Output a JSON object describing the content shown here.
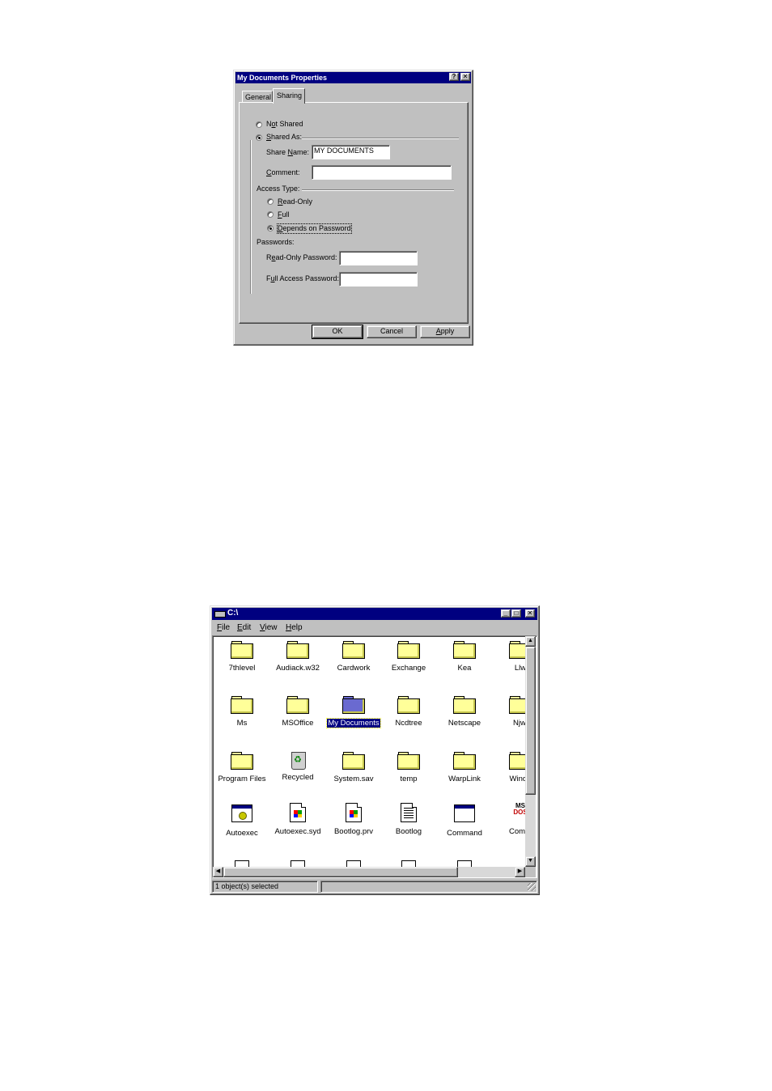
{
  "dialog": {
    "title": "My Documents Properties",
    "help_glyph": "?",
    "close_glyph": "✕",
    "tabs": [
      {
        "label": "General",
        "active": false
      },
      {
        "label": "Sharing",
        "active": true
      }
    ],
    "share_options": [
      {
        "label": "Not Shared",
        "accel_index": 1,
        "selected": false
      },
      {
        "label": "Shared As:",
        "accel_index": 0,
        "selected": true
      }
    ],
    "share_name": {
      "label": "Share Name:",
      "value": "MY DOCUMENTS"
    },
    "comment": {
      "label": "Comment:",
      "value": ""
    },
    "access_type": {
      "label": "Access Type:",
      "options": [
        {
          "label": "Read-Only",
          "selected": false
        },
        {
          "label": "Full",
          "selected": false
        },
        {
          "label": "Depends on Password",
          "selected": true
        }
      ]
    },
    "passwords": {
      "label": "Passwords:",
      "read_only_label": "Read-Only Password:",
      "full_access_label": "Full Access Password:"
    },
    "buttons": {
      "ok": "OK",
      "cancel": "Cancel",
      "apply": "Apply"
    }
  },
  "explorer": {
    "title": "C:\\",
    "controls": {
      "minimize": "_",
      "maximize": "□",
      "close": "✕"
    },
    "menu": [
      "File",
      "Edit",
      "View",
      "Help"
    ],
    "rows": [
      [
        {
          "label": "7thlevel",
          "icon": "folder-icon"
        },
        {
          "label": "Audiack.w32",
          "icon": "folder-icon"
        },
        {
          "label": "Cardwork",
          "icon": "folder-icon"
        },
        {
          "label": "Exchange",
          "icon": "folder-icon"
        },
        {
          "label": "Kea",
          "icon": "folder-icon"
        },
        {
          "label": "Llw",
          "icon": "folder-icon"
        }
      ],
      [
        {
          "label": "Ms",
          "icon": "folder-icon"
        },
        {
          "label": "MSOffice",
          "icon": "folder-icon"
        },
        {
          "label": "My Documents",
          "icon": "shared-folder-icon",
          "selected": true
        },
        {
          "label": "Ncdtree",
          "icon": "folder-icon"
        },
        {
          "label": "Netscape",
          "icon": "folder-icon"
        },
        {
          "label": "Njwi",
          "icon": "folder-icon"
        }
      ],
      [
        {
          "label": "Program Files",
          "icon": "folder-icon"
        },
        {
          "label": "Recycled",
          "icon": "recycle-bin-icon"
        },
        {
          "label": "System.sav",
          "icon": "folder-icon"
        },
        {
          "label": "temp",
          "icon": "folder-icon"
        },
        {
          "label": "WarpLink",
          "icon": "folder-icon"
        },
        {
          "label": "Windo",
          "icon": "folder-icon"
        }
      ],
      [
        {
          "label": "Autoexec",
          "icon": "batch-file-icon"
        },
        {
          "label": "Autoexec.syd",
          "icon": "windows-file-icon"
        },
        {
          "label": "Bootlog.prv",
          "icon": "windows-file-icon"
        },
        {
          "label": "Bootlog",
          "icon": "text-file-icon"
        },
        {
          "label": "Command",
          "icon": "ms-dos-program-icon"
        },
        {
          "label": "Comm",
          "icon": "ms-dos-icon"
        }
      ]
    ],
    "status": {
      "left": "1 object(s) selected",
      "right": ""
    }
  }
}
